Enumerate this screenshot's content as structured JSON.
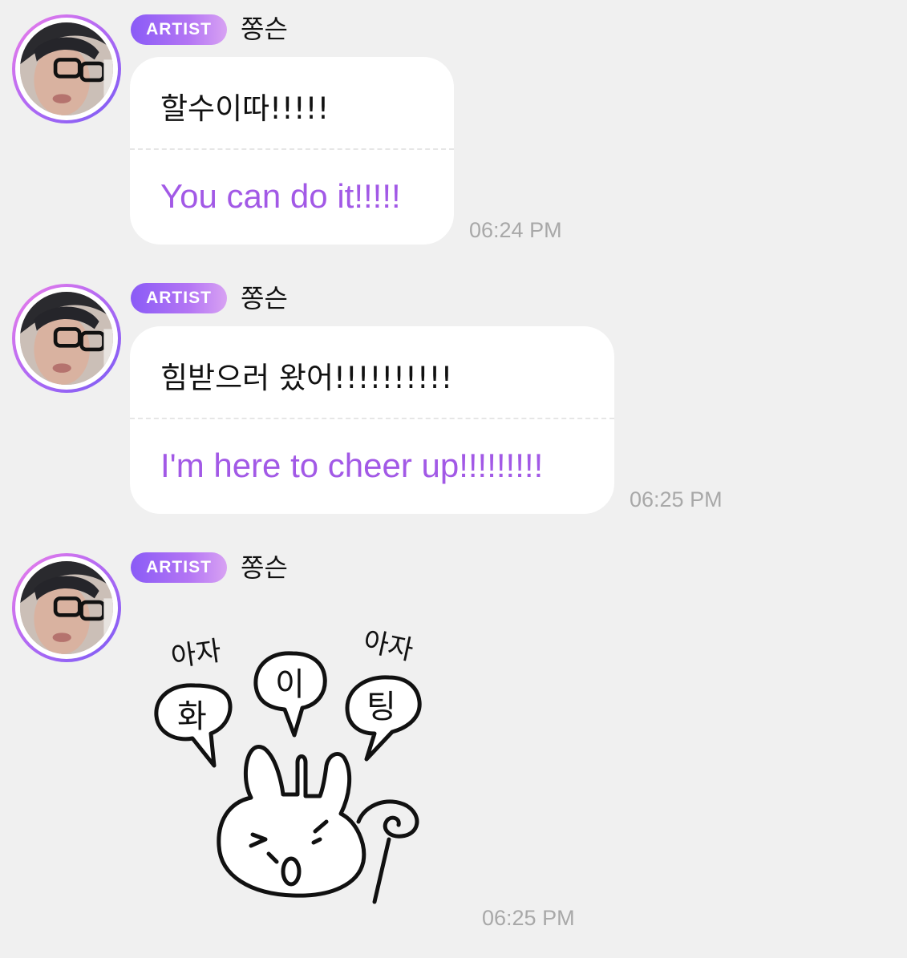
{
  "messages": [
    {
      "badge": "ARTIST",
      "name": "쫑슨",
      "original": "할수이따!!!!!",
      "translation": "You can do it!!!!!",
      "time": "06:24 PM"
    },
    {
      "badge": "ARTIST",
      "name": "쫑슨",
      "original": "힘받으러 왔어!!!!!!!!!!",
      "translation": "I'm here to cheer up!!!!!!!!!",
      "time": "06:25 PM"
    },
    {
      "badge": "ARTIST",
      "name": "쫑슨",
      "time": "06:25 PM",
      "sticker": {
        "icon": "bunny-fighting-sticker",
        "texts": [
          "아자",
          "화",
          "이",
          "팅",
          "아자"
        ]
      }
    }
  ],
  "colors": {
    "background": "#f0f0f0",
    "bubble": "#ffffff",
    "translation": "#a259e6",
    "timestamp": "#a8a8a8",
    "badge_start": "#8a5bf6",
    "badge_end": "#d8a2f3"
  }
}
